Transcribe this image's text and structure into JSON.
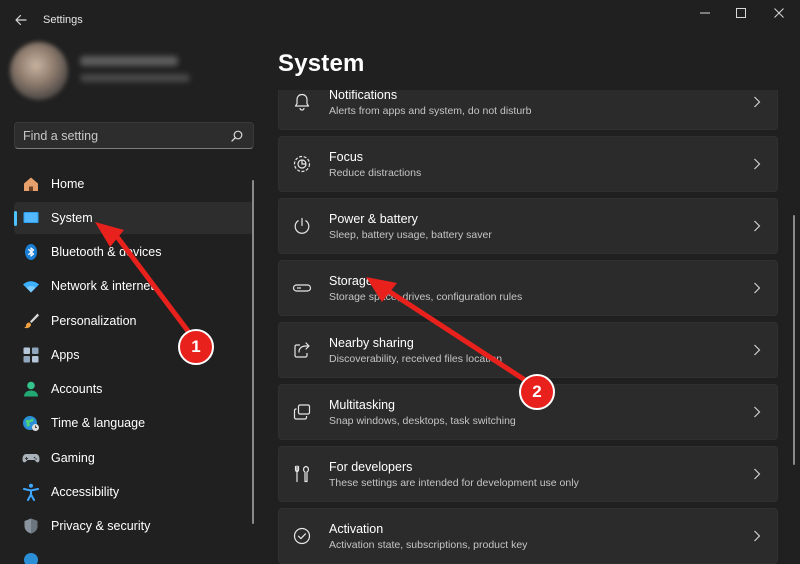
{
  "app": {
    "title": "Settings"
  },
  "window_controls": [
    "minimize-icon",
    "maximize-icon",
    "close-icon"
  ],
  "search": {
    "placeholder": "Find a setting",
    "value": ""
  },
  "sidebar": {
    "items": [
      {
        "label": "Home",
        "icon": "home-icon",
        "active": false
      },
      {
        "label": "System",
        "icon": "system-icon",
        "active": true
      },
      {
        "label": "Bluetooth & devices",
        "icon": "bluetooth-icon",
        "active": false
      },
      {
        "label": "Network & internet",
        "icon": "wifi-icon",
        "active": false
      },
      {
        "label": "Personalization",
        "icon": "brush-icon",
        "active": false
      },
      {
        "label": "Apps",
        "icon": "apps-icon",
        "active": false
      },
      {
        "label": "Accounts",
        "icon": "accounts-icon",
        "active": false
      },
      {
        "label": "Time & language",
        "icon": "globe-icon",
        "active": false
      },
      {
        "label": "Gaming",
        "icon": "gamepad-icon",
        "active": false
      },
      {
        "label": "Accessibility",
        "icon": "accessibility-icon",
        "active": false
      },
      {
        "label": "Privacy & security",
        "icon": "shield-icon",
        "active": false
      }
    ]
  },
  "main": {
    "title": "System",
    "cards": [
      {
        "title": "Notifications",
        "description": "Alerts from apps and system, do not disturb",
        "icon": "bell-icon"
      },
      {
        "title": "Focus",
        "description": "Reduce distractions",
        "icon": "focus-icon"
      },
      {
        "title": "Power & battery",
        "description": "Sleep, battery usage, battery saver",
        "icon": "power-icon"
      },
      {
        "title": "Storage",
        "description": "Storage space, drives, configuration rules",
        "icon": "storage-icon"
      },
      {
        "title": "Nearby sharing",
        "description": "Discoverability, received files location",
        "icon": "share-icon"
      },
      {
        "title": "Multitasking",
        "description": "Snap windows, desktops, task switching",
        "icon": "multitasking-icon"
      },
      {
        "title": "For developers",
        "description": "These settings are intended for development use only",
        "icon": "developer-tools-icon"
      },
      {
        "title": "Activation",
        "description": "Activation state, subscriptions, product key",
        "icon": "activation-check-icon"
      }
    ]
  },
  "annotations": [
    {
      "number": "1"
    },
    {
      "number": "2"
    }
  ],
  "colors": {
    "accent": "#4cc2ff",
    "annotation": "#e8211d",
    "background": "#202020",
    "card": "#2b2b2b"
  }
}
